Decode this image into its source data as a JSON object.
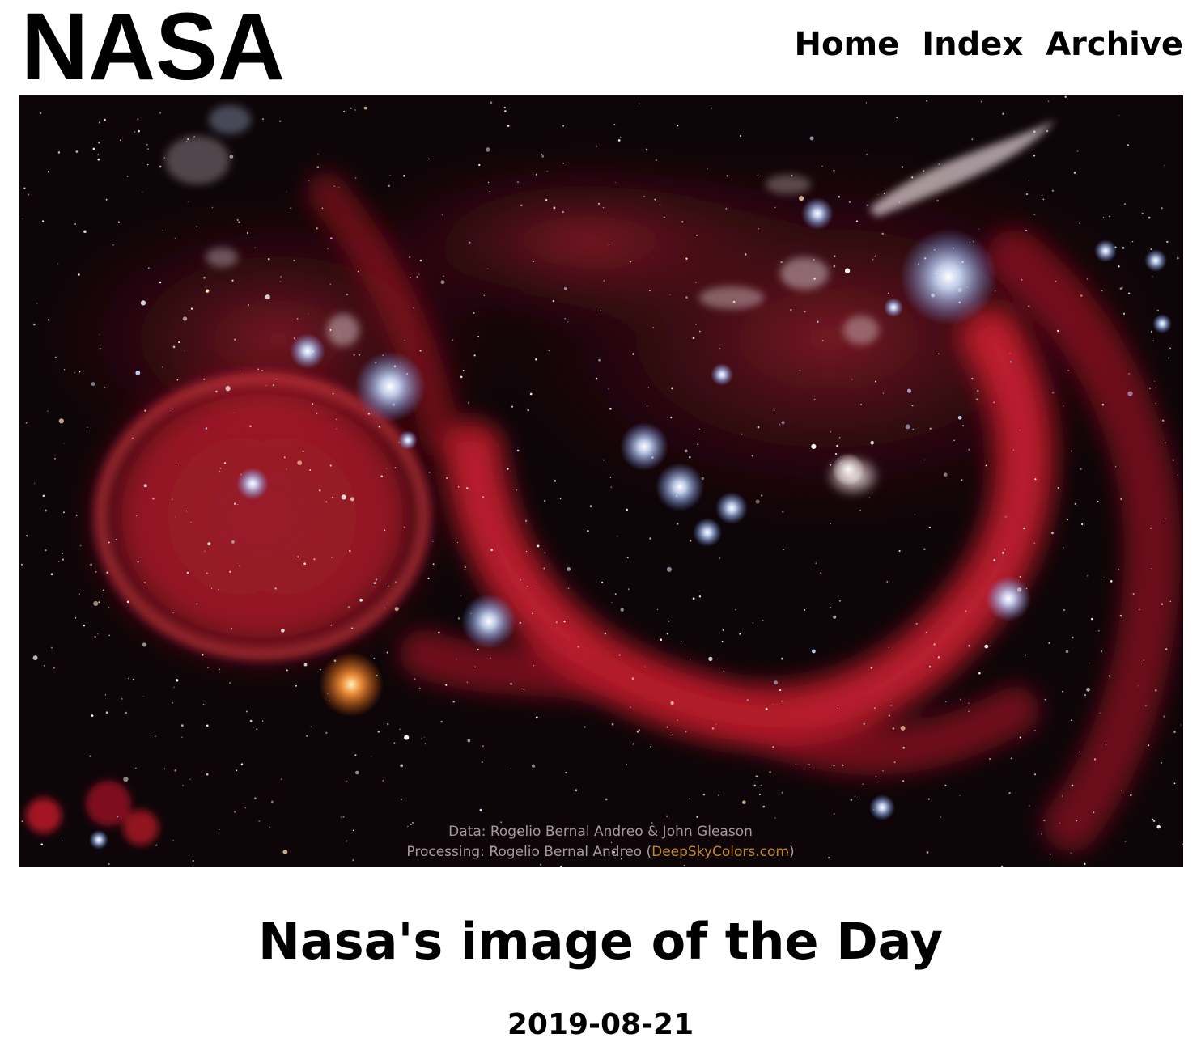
{
  "brand": {
    "logo_text": "NASA"
  },
  "nav": {
    "items": [
      {
        "label": "Home"
      },
      {
        "label": "Index"
      },
      {
        "label": "Archive"
      }
    ]
  },
  "image": {
    "credit_data": "Data: Rogelio Bernal Andreo & John Gleason",
    "credit_processing_prefix": "Processing: Rogelio Bernal Andreo (",
    "credit_processing_link": "DeepSkyColors.com",
    "credit_processing_suffix": ")",
    "colors": {
      "nebula_red": "#c81a2a",
      "space_dark": "#0d0508",
      "star_blue": "#9fc4ff",
      "star_orange": "#ff9a3c",
      "credit_link": "#e0a030"
    }
  },
  "content": {
    "title": "Nasa's image of the Day",
    "date": "2019-08-21"
  }
}
